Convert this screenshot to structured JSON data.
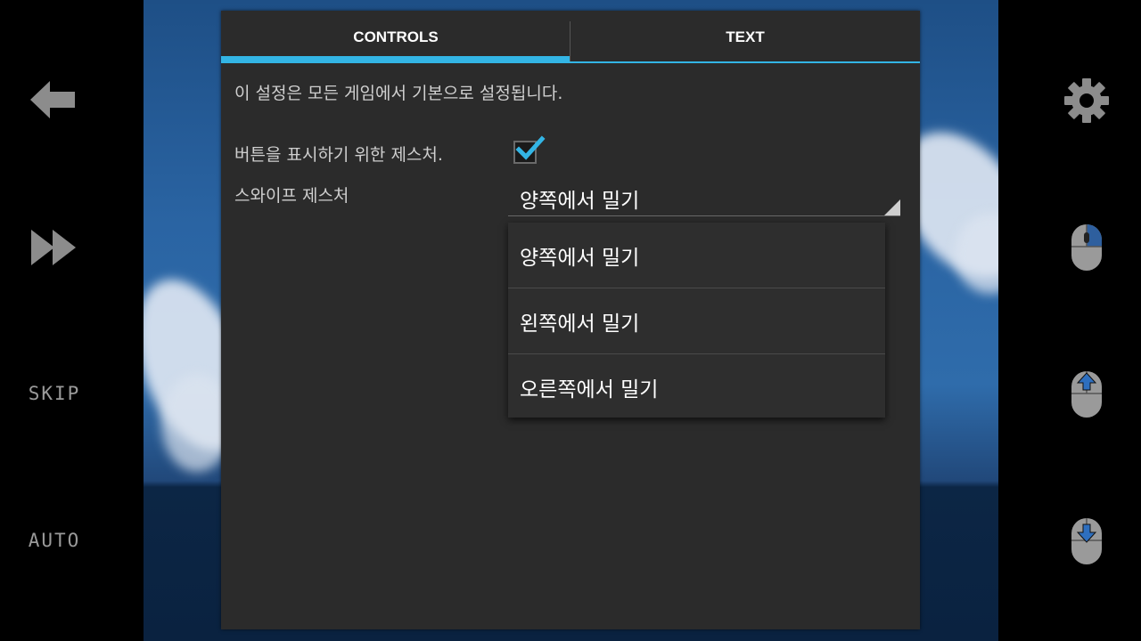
{
  "left_bar": {
    "back_icon": "back-arrow-icon",
    "fast_forward_icon": "fast-forward-icon",
    "skip_label": "SKIP",
    "auto_label": "AUTO"
  },
  "right_bar": {
    "settings_icon": "gear-icon",
    "mouse_icons": [
      "mouse-right-click-icon",
      "mouse-scroll-up-icon",
      "mouse-scroll-down-icon"
    ]
  },
  "dialog": {
    "tabs": [
      {
        "label": "CONTROLS",
        "selected": true
      },
      {
        "label": "TEXT",
        "selected": false
      }
    ],
    "description": "이 설정은 모든 게임에서 기본으로 설정됩니다.",
    "gesture_label": "버튼을 표시하기 위한 제스처.",
    "gesture_checked": true,
    "swipe_label": "스와이프 제스처",
    "swipe_value": "양쪽에서 밀기",
    "swipe_options": [
      "양쪽에서 밀기",
      "왼쪽에서 밀기",
      "오른쪽에서 밀기"
    ]
  },
  "colors": {
    "accent": "#33b5e5",
    "dialog_bg": "#2b2b2b",
    "side_text": "#9a9a9a"
  }
}
